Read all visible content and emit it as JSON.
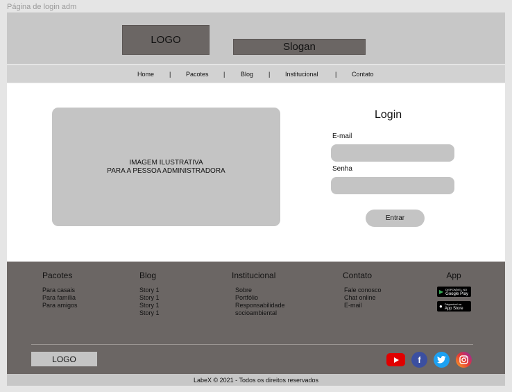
{
  "frame_title": "Página de login adm",
  "header": {
    "logo": "LOGO",
    "slogan": "Slogan"
  },
  "nav": {
    "items": [
      "Home",
      "Pacotes",
      "Blog",
      "Institucional",
      "Contato"
    ],
    "separator": "|"
  },
  "hero": {
    "image_text_line1": "IMAGEM ILUSTRATIVA",
    "image_text_line2": "PARA A PESSOA ADMINISTRADORA"
  },
  "login": {
    "title": "Login",
    "email_label": "E-mail",
    "email_value": "",
    "password_label": "Senha",
    "password_value": "",
    "submit_label": "Entrar"
  },
  "footer": {
    "columns": [
      {
        "title": "Pacotes",
        "items": [
          "Para casais",
          "Para família",
          "Para amigos"
        ]
      },
      {
        "title": "Blog",
        "items": [
          "Story 1",
          "Story 1",
          "Story 1",
          "Story 1"
        ]
      },
      {
        "title": "Institucional",
        "items": [
          "Sobre",
          "Portfólio",
          "Responsabilidade",
          "socioambiental"
        ]
      },
      {
        "title": "Contato",
        "items": [
          "Fale conosco",
          "Chat online",
          "E-mail"
        ]
      }
    ],
    "app": {
      "title": "App",
      "google_play": {
        "small": "DISPONÍVEL NO",
        "name": "Google Play"
      },
      "app_store": {
        "small": "Disponível na",
        "name": "App Store"
      }
    },
    "logo": "LOGO",
    "social": [
      {
        "icon": "youtube-icon",
        "color": "#e00000"
      },
      {
        "icon": "facebook-icon",
        "color": "#3b4fa0"
      },
      {
        "icon": "twitter-icon",
        "color": "#1da1f2"
      },
      {
        "icon": "instagram-icon",
        "color": "#c13584"
      }
    ],
    "copyright": "LabeX © 2021 - Todos os direitos reservados"
  }
}
